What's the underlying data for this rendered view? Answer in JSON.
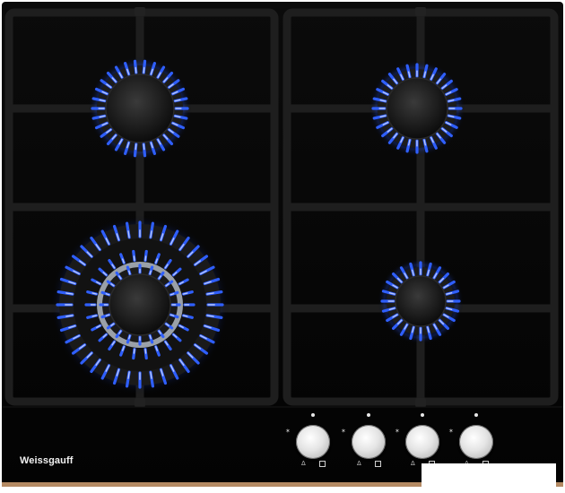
{
  "product": {
    "brand_label": "Weissgauff",
    "surface_color": "#050505",
    "grate_color": "#1f1f1f",
    "trim_color": "#b48a63",
    "flame_color": "#2f5fff"
  },
  "burners": [
    {
      "name": "rear-left",
      "type": "standard"
    },
    {
      "name": "rear-right",
      "type": "standard"
    },
    {
      "name": "front-left",
      "type": "wok-triple-crown"
    },
    {
      "name": "front-right",
      "type": "auxiliary"
    }
  ],
  "controls": {
    "knob_count": 4,
    "icons": [
      "spark-icon",
      "flame-icon",
      "burner-indicator-icon"
    ]
  }
}
